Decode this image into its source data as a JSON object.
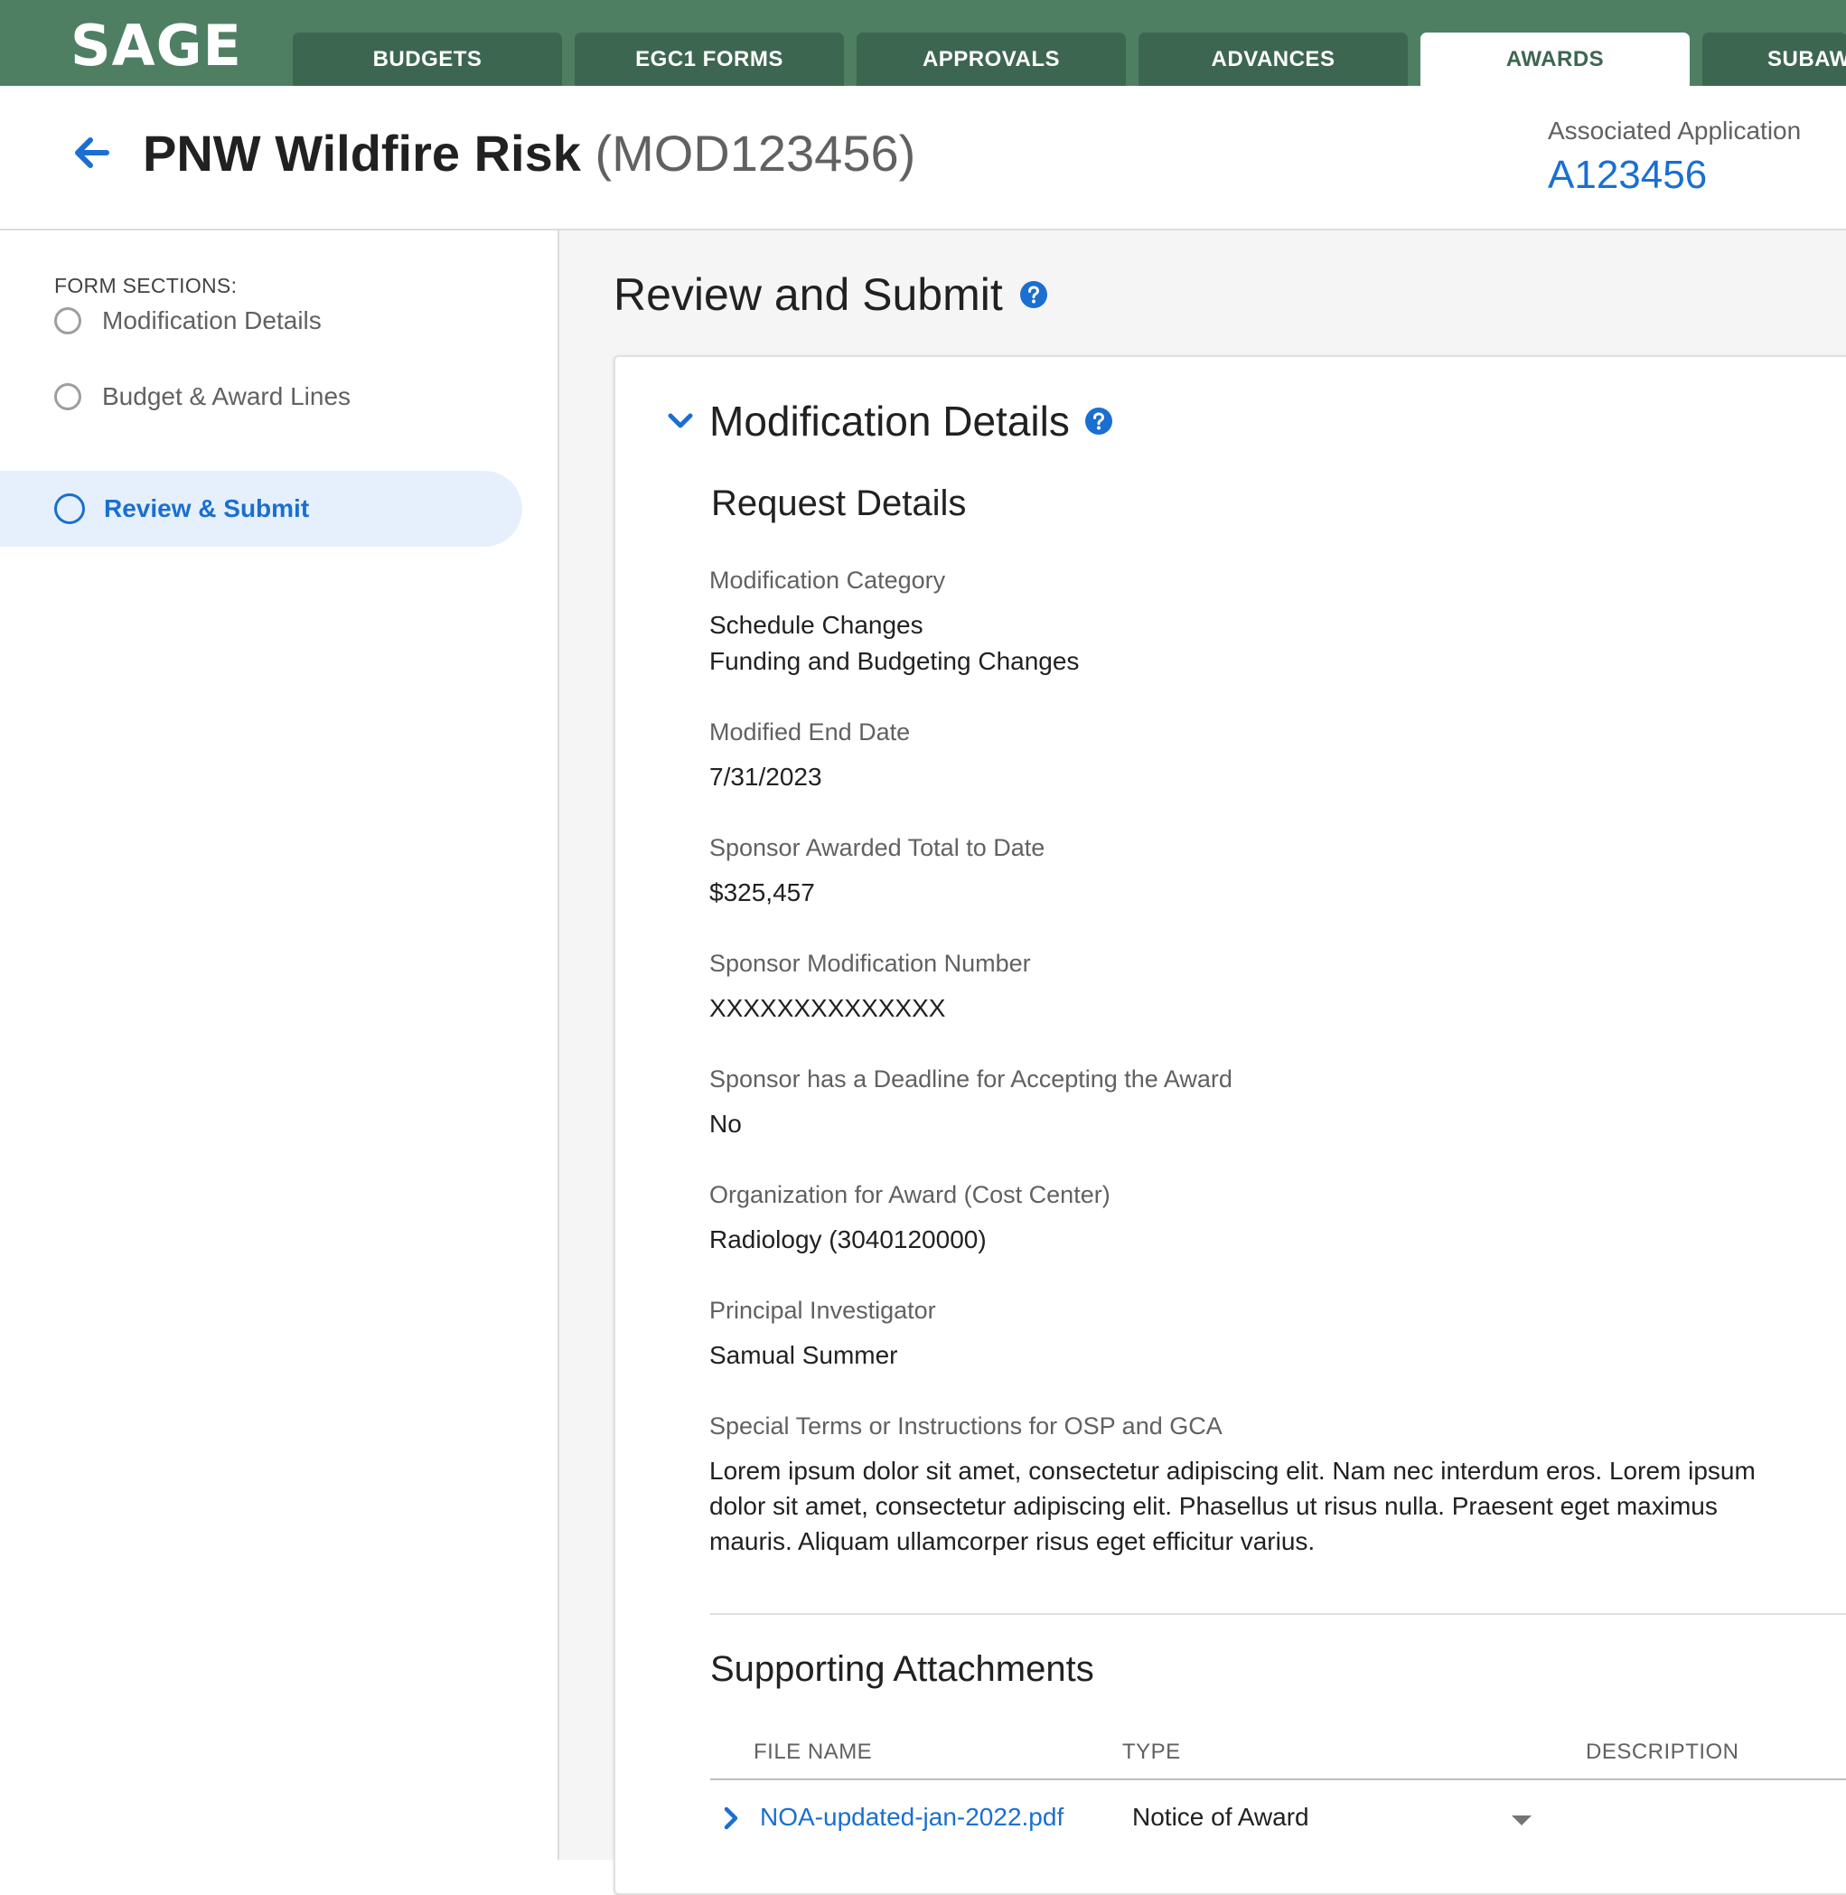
{
  "app": {
    "logo": "SAGE"
  },
  "tabs": [
    {
      "label": "BUDGETS"
    },
    {
      "label": "EGC1 FORMS"
    },
    {
      "label": "APPROVALS"
    },
    {
      "label": "ADVANCES"
    },
    {
      "label": "AWARDS"
    },
    {
      "label": "SUBAW"
    }
  ],
  "header": {
    "title": "PNW Wildfire Risk",
    "id": "(MOD123456)",
    "associated_label": "Associated Application",
    "associated_value": "A123456"
  },
  "sidebar": {
    "heading": "FORM SECTIONS:",
    "items": [
      {
        "label": "Modification Details"
      },
      {
        "label": "Budget & Award Lines"
      },
      {
        "label": "Review & Submit"
      }
    ]
  },
  "main": {
    "title": "Review and Submit",
    "section_title": "Modification Details",
    "request_heading": "Request Details",
    "fields": {
      "category_label": "Modification Category",
      "category_value_1": "Schedule Changes",
      "category_value_2": "Funding and Budgeting Changes",
      "end_date_label": "Modified End Date",
      "end_date_value": "7/31/2023",
      "total_label": "Sponsor Awarded Total to Date",
      "total_value": "$325,457",
      "mod_number_label": "Sponsor Modification Number",
      "mod_number_value": "XXXXXXXXXXXXXX",
      "deadline_label": "Sponsor has a Deadline for Accepting the Award",
      "deadline_value": "No",
      "org_label": "Organization for Award (Cost Center)",
      "org_value": "Radiology (3040120000)",
      "pi_label": "Principal Investigator",
      "pi_value": "Samual Summer",
      "terms_label": "Special Terms or Instructions for OSP and GCA",
      "terms_value": "Lorem ipsum dolor sit amet, consectetur adipiscing elit. Nam nec interdum eros. Lorem ipsum dolor sit amet, consectetur adipiscing elit. Phasellus ut risus nulla. Praesent eget maximus mauris. Aliquam ullamcorper risus eget efficitur varius."
    },
    "attachments": {
      "heading": "Supporting Attachments",
      "columns": [
        "FILE NAME",
        "TYPE",
        "DESCRIPTION"
      ],
      "rows": [
        {
          "file": "NOA-updated-jan-2022.pdf",
          "type": "Notice of Award"
        }
      ]
    }
  },
  "colors": {
    "topbar": "#4e7f63",
    "tab": "#3d6650",
    "accent": "#1a6fd0",
    "active_bg": "#e5f0fc"
  },
  "icons": {
    "back": "arrow-left-icon",
    "help": "question-circle-icon",
    "collapse": "chevron-down-icon",
    "expand_row": "chevron-right-icon",
    "dropdown": "caret-down-icon",
    "section_status": "circle-outline-icon"
  }
}
